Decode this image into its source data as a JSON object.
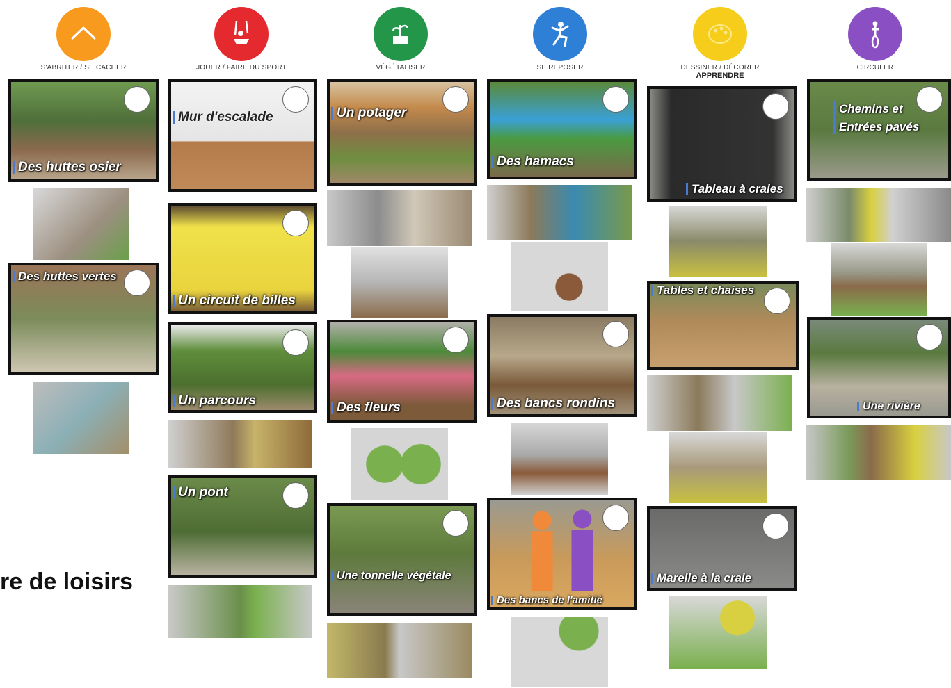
{
  "categories": [
    {
      "label": "S'ABRITER / SE CACHER",
      "color": "#f79a1e",
      "icon": "shelter-icon"
    },
    {
      "label": "JOUER / FAIRE DU SPORT",
      "color": "#e52a2f",
      "icon": "swing-icon"
    },
    {
      "label": "VÉGÉTALISER",
      "color": "#23964a",
      "icon": "plant-icon"
    },
    {
      "label": "SE REPOSER",
      "color": "#2e7fd6",
      "icon": "relax-icon"
    },
    {
      "label": "DESSINER / DÉCORER",
      "sublabel": "APPRENDRE",
      "color": "#f5cd1a",
      "icon": "palette-icon"
    },
    {
      "label": "CIRCULER",
      "color": "#8a4fc2",
      "icon": "bike-icon"
    }
  ],
  "cards": [
    {
      "caption": "Des huttes osier"
    },
    {
      "caption": "Des huttes vertes"
    },
    {
      "caption": "Mur d'escalade"
    },
    {
      "caption": "Un circuit de billes"
    },
    {
      "caption": "Un parcours"
    },
    {
      "caption": "Un pont"
    },
    {
      "caption": "Un potager"
    },
    {
      "caption": "Des fleurs"
    },
    {
      "caption": "Une tonnelle végétale"
    },
    {
      "caption": "Des hamacs"
    },
    {
      "caption": "Des bancs rondins"
    },
    {
      "caption": "Des bancs de l'amitié"
    },
    {
      "caption": "Tableau à craies"
    },
    {
      "caption": "Tables et chaises"
    },
    {
      "caption": "Marelle à la craie"
    },
    {
      "caption": "Chemins et Entrées pavés"
    },
    {
      "caption": "Une rivière"
    }
  ],
  "side_title": "re de loisirs",
  "colors": {
    "card_border": "#111111",
    "caption_marker": "#4a7bd0"
  }
}
